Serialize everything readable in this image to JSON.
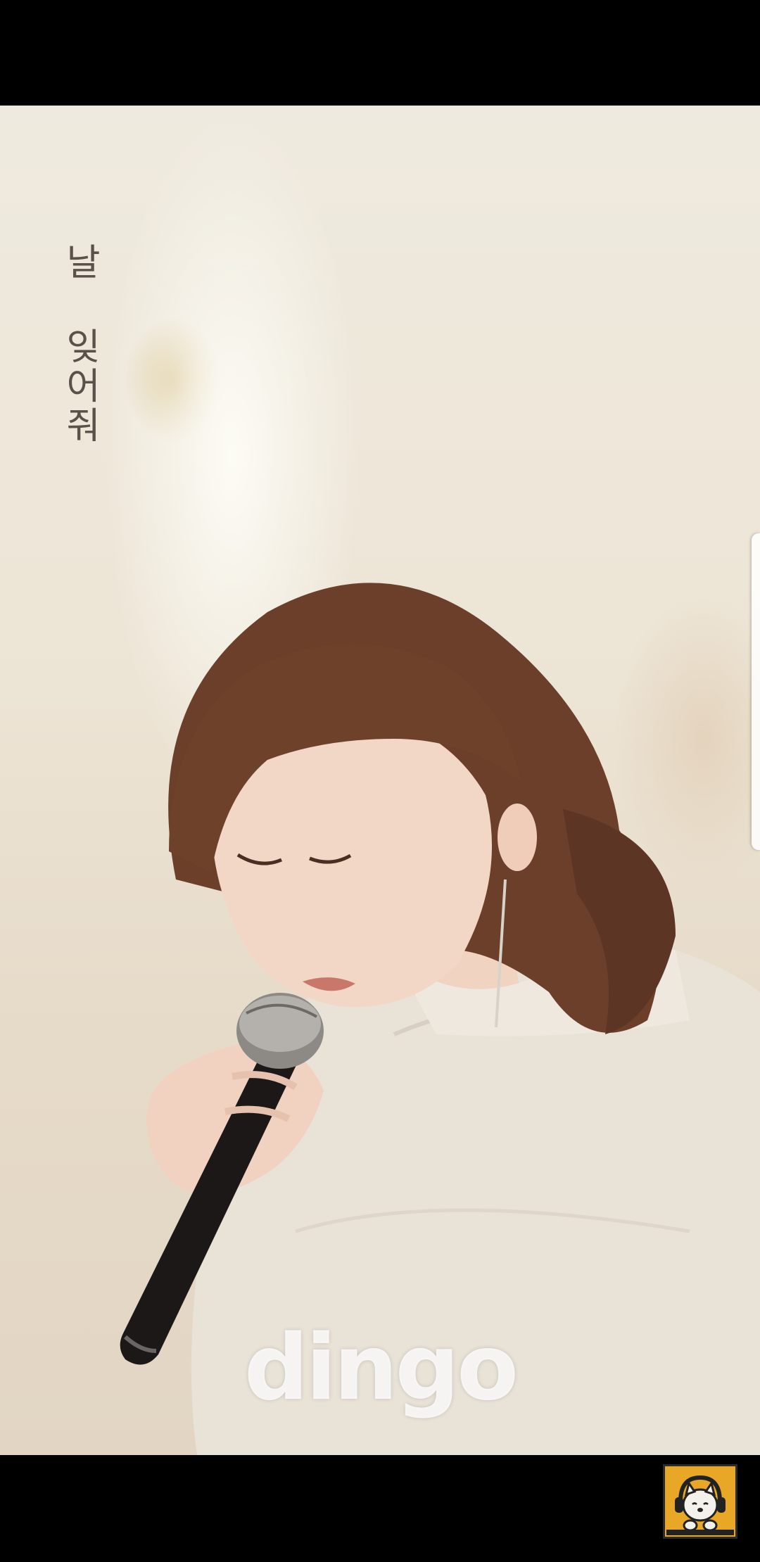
{
  "video": {
    "title_overlay": "날 잊어줘",
    "watermark": "dingo"
  },
  "channel": {
    "avatar_icon": "dog-with-headphones-icon",
    "avatar_color": "#e8a726"
  }
}
